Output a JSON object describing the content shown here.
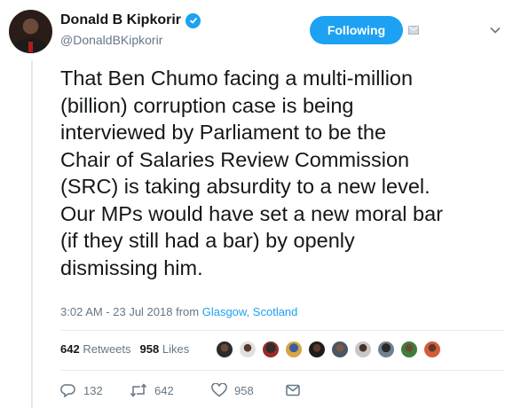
{
  "tweet": {
    "display_name": "Donald B Kipkorir",
    "handle": "@DonaldBKipkorir",
    "follow_label": "Following",
    "text": "That Ben Chumo facing a multi-million\n(billion) corruption case is being\ninterviewed by Parliament to be the\nChair of Salaries Review Commission\n(SRC) is taking absurdity to a new level.\nOur MPs would have set a new moral bar\n(if they still had a bar) by openly\ndismissing him.",
    "timestamp": "3:02 AM - 23 Jul 2018 from",
    "location": "Glasgow, Scotland"
  },
  "stats": {
    "retweets_count": "642",
    "retweets_label": "Retweets",
    "likes_count": "958",
    "likes_label": "Likes"
  },
  "actions": {
    "reply_count": "132",
    "retweet_count": "642",
    "like_count": "958"
  },
  "colors": {
    "accent": "#1da1f2",
    "text": "#14171a",
    "muted": "#657786"
  },
  "icons": [
    "verified-badge-icon",
    "direct-message-icon",
    "chevron-down-icon",
    "reply-icon",
    "retweet-icon",
    "like-icon",
    "direct-message-icon"
  ]
}
